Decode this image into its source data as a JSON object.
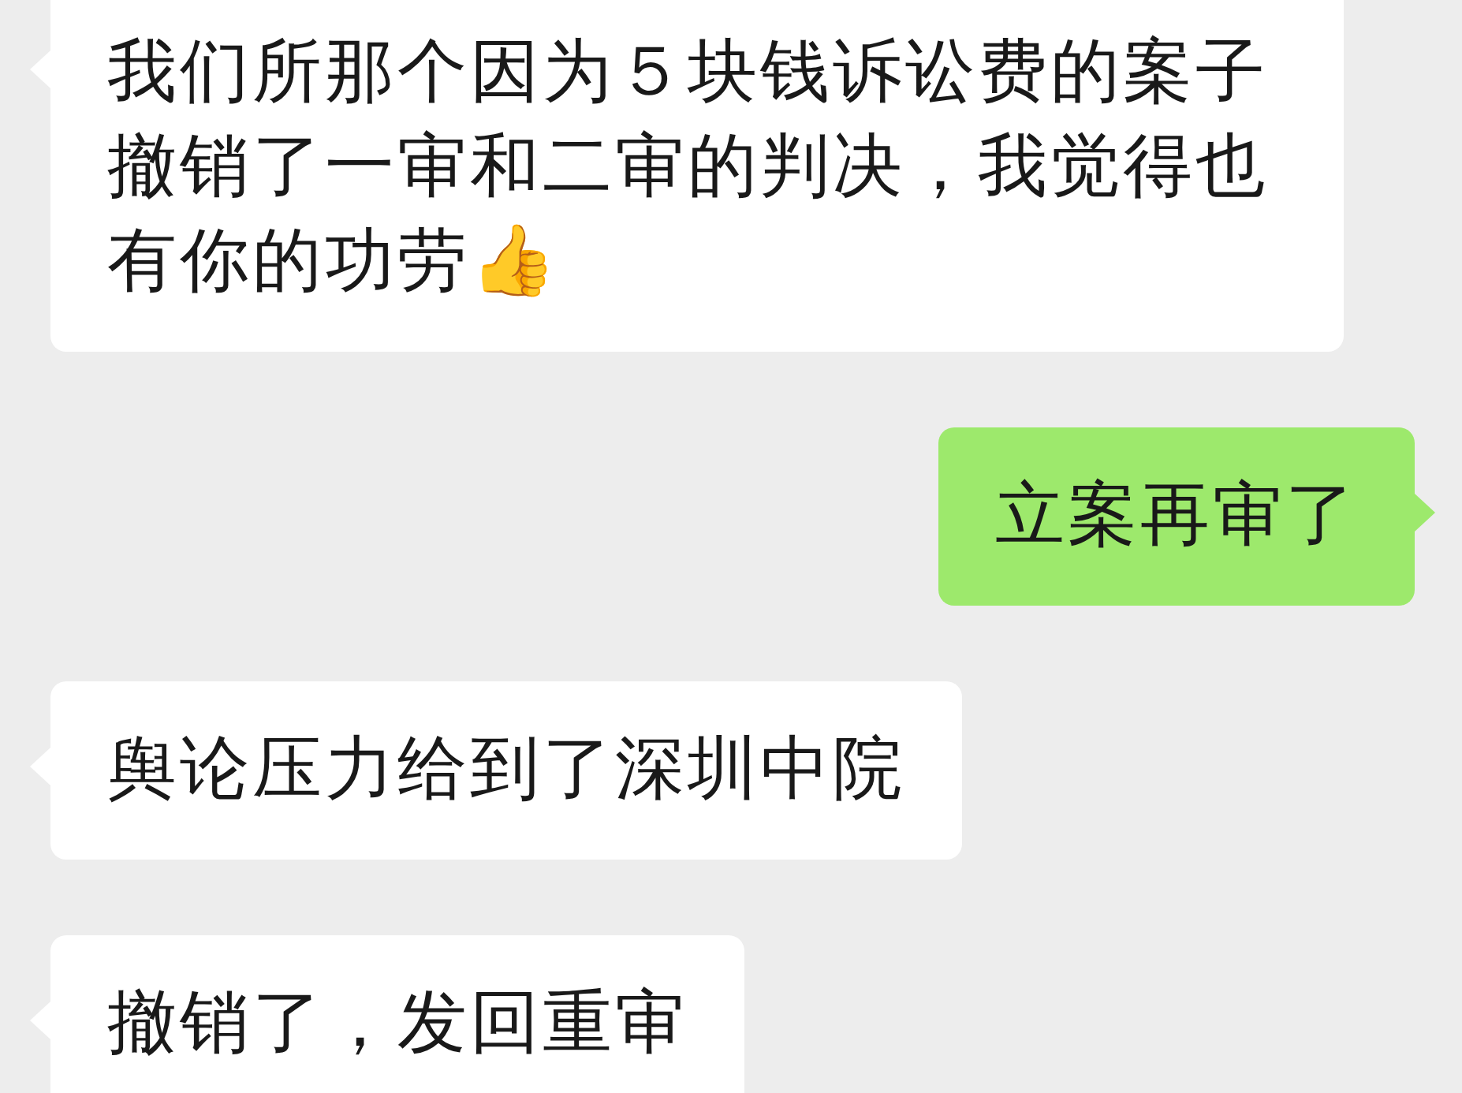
{
  "messages": [
    {
      "kind": "received",
      "text": "我们所那个因为５块钱诉讼费的案子撤销了一审和二审的判决，我觉得也有你的功劳👍"
    },
    {
      "kind": "sent",
      "text": "立案再审了"
    },
    {
      "kind": "received",
      "text": "舆论压力给到了深圳中院"
    },
    {
      "kind": "received",
      "text": "撤销了，发回重审"
    }
  ]
}
